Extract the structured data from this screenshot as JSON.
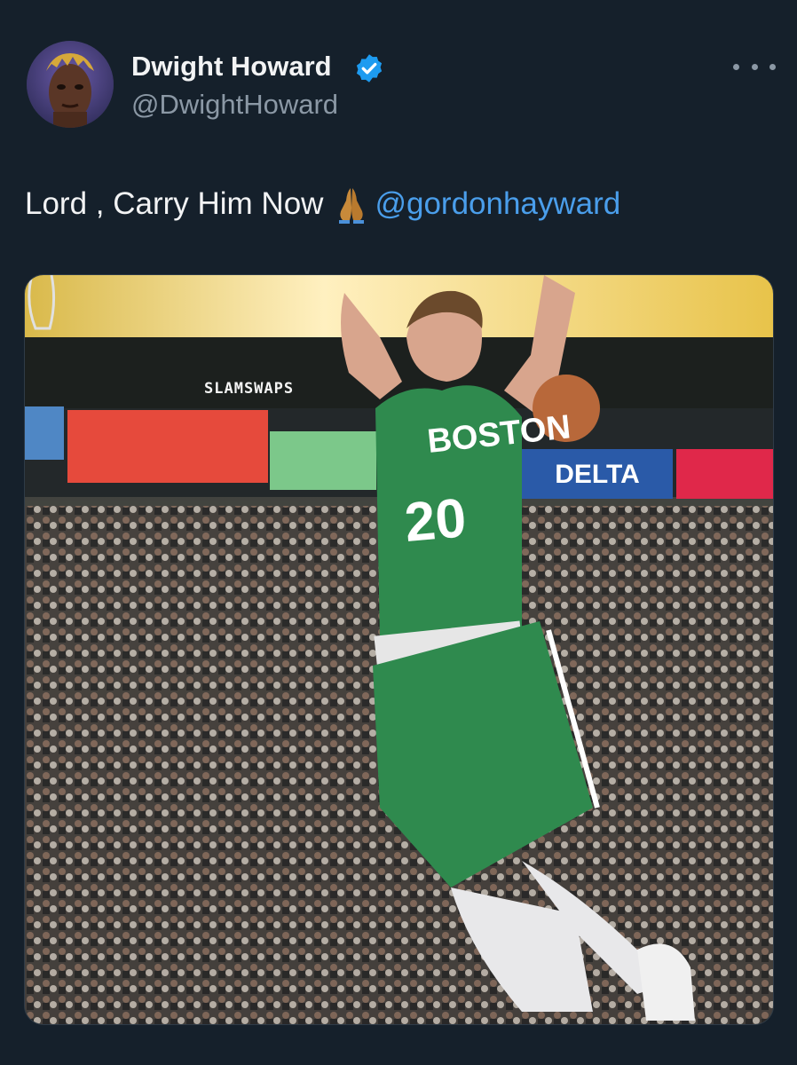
{
  "author": {
    "display_name": "Dwight Howard",
    "handle": "@DwightHoward",
    "verified": true,
    "verified_color": "#1d9bf0"
  },
  "tweet": {
    "text": "Lord , Carry Him Now",
    "emoji_icon": "folded-hands-icon",
    "mention": "@gordonhayward",
    "mention_color": "#4a9eeb"
  },
  "media": {
    "watermark": "SLAMSWAPS",
    "jersey_text": "BOSTON",
    "jersey_number": "20",
    "banners": [
      "Delta"
    ]
  },
  "menu_icon": "more-options-icon",
  "colors": {
    "background": "#15202b",
    "primary_text": "#f2f3f4",
    "secondary_text": "#8b98a5"
  }
}
